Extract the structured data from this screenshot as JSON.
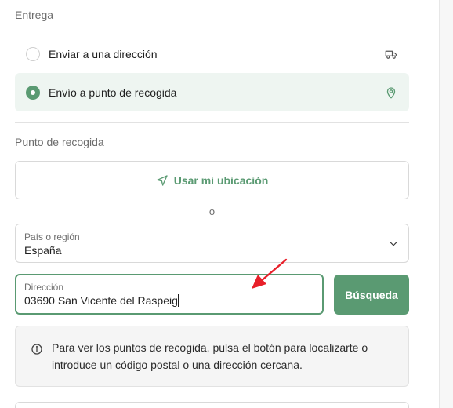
{
  "delivery": {
    "title": "Entrega",
    "options": [
      {
        "label": "Enviar a una dirección",
        "selected": false,
        "icon": "delivery-truck-icon"
      },
      {
        "label": "Envío a punto de recogida",
        "selected": true,
        "icon": "map-pin-icon"
      }
    ]
  },
  "pickup": {
    "title": "Punto de recogida",
    "use_location_label": "Usar mi ubicación",
    "or_text": "o",
    "country": {
      "label": "País o región",
      "value": "España"
    },
    "address": {
      "label": "Dirección",
      "value": "03690 San Vicente del Raspeig"
    },
    "search_label": "Búsqueda",
    "info_text": "Para ver los puntos de recogida, pulsa el botón para localizarte o introduce un código postal o una dirección cercana."
  },
  "colors": {
    "accent": "#5a9a72",
    "selected_bg": "#eef5f1",
    "annotation_arrow": "#e8202a"
  }
}
